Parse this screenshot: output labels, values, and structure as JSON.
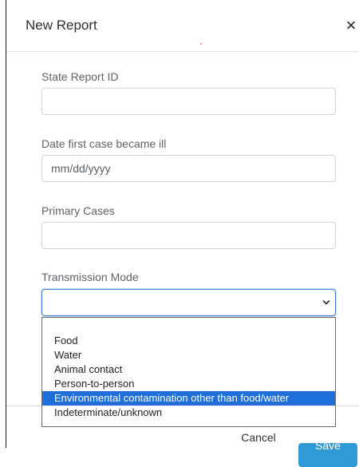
{
  "header": {
    "title": "New Report",
    "close_glyph": "×",
    "close_icon": "close-icon"
  },
  "form": {
    "state_report_id": {
      "label": "State Report ID",
      "value": ""
    },
    "date_first_ill": {
      "label": "Date first case became ill",
      "placeholder": "mm/dd/yyyy",
      "value": ""
    },
    "primary_cases": {
      "label": "Primary Cases",
      "value": ""
    },
    "transmission_mode": {
      "label": "Transmission Mode",
      "selected_value": "",
      "chevron_icon": "chevron-down-icon",
      "options": [
        "",
        "Food",
        "Water",
        "Animal contact",
        "Person-to-person",
        "Environmental contamination other than food/water",
        "Indeterminate/unknown"
      ],
      "highlighted_option": "Environmental contamination other than food/water"
    }
  },
  "footer": {
    "cancel_label": "Cancel",
    "save_label": "Save"
  },
  "colors": {
    "accent": "#2f9ad6",
    "highlight": "#1e6fd9",
    "focus_border": "#3f7fd0"
  }
}
